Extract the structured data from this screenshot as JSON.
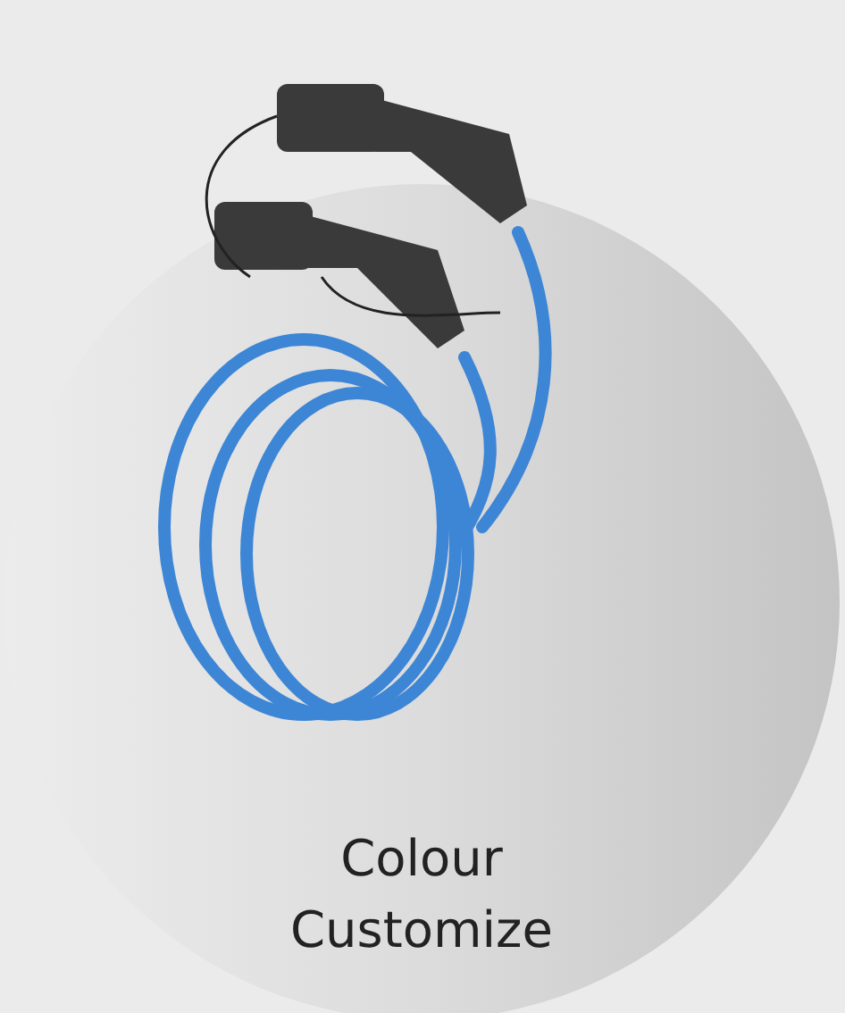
{
  "caption": "Colour Customize"
}
